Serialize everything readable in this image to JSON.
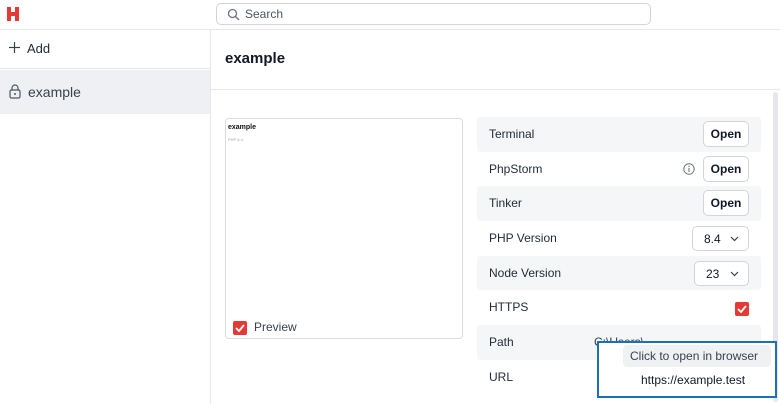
{
  "search": {
    "placeholder": "Search"
  },
  "sidebar": {
    "add_label": "Add",
    "items": [
      {
        "label": "example",
        "icon": "lock-icon"
      }
    ]
  },
  "main": {
    "title": "example",
    "preview": {
      "mini_title": "example",
      "mini_subtitle": "PHP 8.4",
      "checkbox_label": "Preview",
      "checked": true
    },
    "settings": {
      "terminal": {
        "label": "Terminal",
        "action": "Open"
      },
      "phpstorm": {
        "label": "PhpStorm",
        "action": "Open"
      },
      "tinker": {
        "label": "Tinker",
        "action": "Open"
      },
      "php_version": {
        "label": "PHP Version",
        "value": "8.4"
      },
      "node_version": {
        "label": "Node Version",
        "value": "23"
      },
      "https": {
        "label": "HTTPS",
        "checked": true
      },
      "path": {
        "label": "Path",
        "value": "C:\\Users\\..."
      },
      "url": {
        "label": "URL"
      }
    }
  },
  "tooltip": {
    "text": "Click to open in browser",
    "url": "https://example.test"
  },
  "colors": {
    "brand": "#e53935",
    "accent": "#1d6fb8"
  }
}
